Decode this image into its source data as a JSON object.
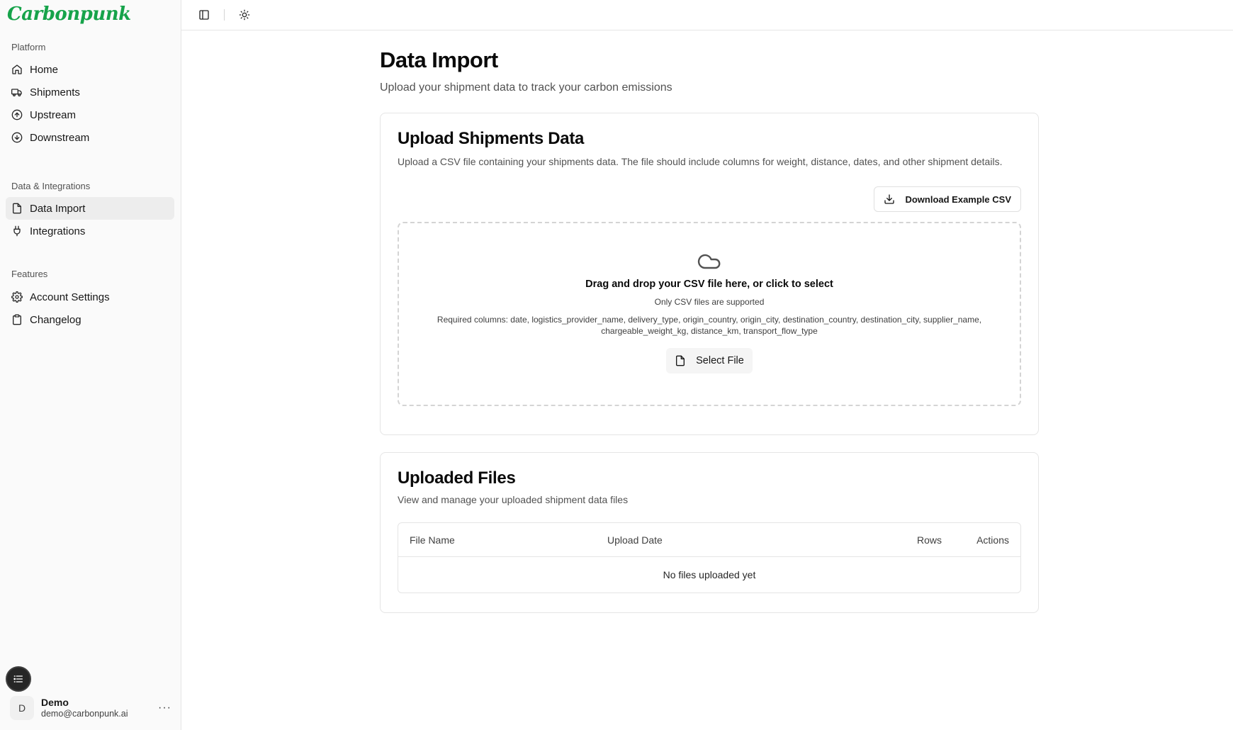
{
  "brand": {
    "name": "Carbonpunk",
    "color": "#16a34a"
  },
  "sidebar": {
    "groups": [
      {
        "label": "Platform",
        "items": [
          {
            "label": "Home",
            "icon": "home-icon"
          },
          {
            "label": "Shipments",
            "icon": "truck-icon"
          },
          {
            "label": "Upstream",
            "icon": "arrow-up-circle-icon"
          },
          {
            "label": "Downstream",
            "icon": "arrow-down-circle-icon"
          }
        ]
      },
      {
        "label": "Data & Integrations",
        "items": [
          {
            "label": "Data Import",
            "icon": "file-icon",
            "active": true
          },
          {
            "label": "Integrations",
            "icon": "plug-icon"
          }
        ]
      },
      {
        "label": "Features",
        "items": [
          {
            "label": "Account Settings",
            "icon": "gear-icon"
          },
          {
            "label": "Changelog",
            "icon": "clipboard-icon"
          }
        ]
      }
    ],
    "user": {
      "initial": "D",
      "name": "Demo",
      "email": "demo@carbonpunk.ai",
      "more": "···"
    }
  },
  "page": {
    "title": "Data Import",
    "subtitle": "Upload your shipment data to track your carbon emissions"
  },
  "upload_card": {
    "title": "Upload Shipments Data",
    "description": "Upload a CSV file containing your shipments data. The file should include columns for weight, distance, dates, and other shipment details.",
    "download_label": "Download Example CSV",
    "dropzone": {
      "title": "Drag and drop your CSV file here, or click to select",
      "hint": "Only CSV files are supported",
      "required_columns": "Required columns: date, logistics_provider_name, delivery_type, origin_country, origin_city, destination_country, destination_city, supplier_name, chargeable_weight_kg, distance_km, transport_flow_type",
      "select_label": "Select File"
    }
  },
  "files_card": {
    "title": "Uploaded Files",
    "description": "View and manage your uploaded shipment data files",
    "columns": [
      "File Name",
      "Upload Date",
      "Rows",
      "Actions"
    ],
    "empty_text": "No files uploaded yet"
  }
}
